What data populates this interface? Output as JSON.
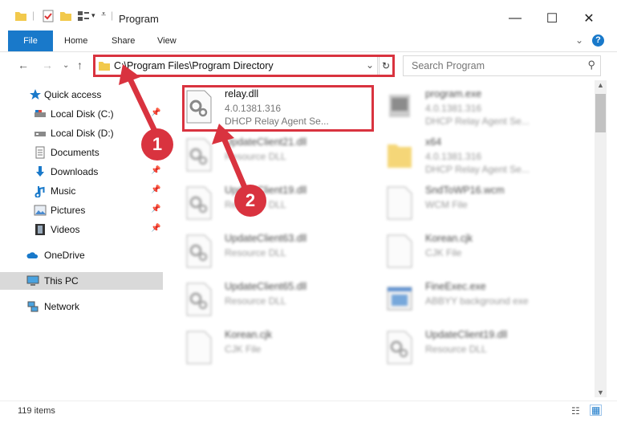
{
  "window": {
    "title": "Program",
    "minimize_glyph": "—",
    "maximize_glyph": "☐",
    "close_glyph": "✕"
  },
  "ribbon": {
    "tabs": [
      "File",
      "Home",
      "Share",
      "View"
    ]
  },
  "address": {
    "path": "C:\\Program Files\\Program Directory",
    "search_placeholder": "Search Program"
  },
  "nav": {
    "items": [
      {
        "label": "Quick access",
        "icon": "star-icon",
        "pinned": false
      },
      {
        "label": "Local Disk (C:)",
        "icon": "drive-icon",
        "pinned": true
      },
      {
        "label": "Local Disk (D:)",
        "icon": "drive-icon",
        "pinned": false
      },
      {
        "label": "Documents",
        "icon": "documents-icon",
        "pinned": false
      },
      {
        "label": "Downloads",
        "icon": "downloads-icon",
        "pinned": true
      },
      {
        "label": "Music",
        "icon": "music-icon",
        "pinned": true
      },
      {
        "label": "Pictures",
        "icon": "pictures-icon",
        "pinned": true
      },
      {
        "label": "Videos",
        "icon": "videos-icon",
        "pinned": true
      },
      {
        "label": "OneDrive",
        "icon": "onedrive-icon",
        "pinned": false
      },
      {
        "label": "This PC",
        "icon": "this-pc-icon",
        "pinned": false,
        "selected": true
      },
      {
        "label": "Network",
        "icon": "network-icon",
        "pinned": false
      }
    ]
  },
  "files": [
    {
      "name": "relay.dll",
      "line1": "4.0.1381.316",
      "line2": "DHCP Relay Agent Se...",
      "icon": "dll-gear-icon",
      "highlighted": true
    },
    {
      "name": "program.exe",
      "line1": "4.0.1381.316",
      "line2": "DHCP Relay Agent Se...",
      "icon": "exe-icon"
    },
    {
      "name": "UpdateClient21.dll",
      "line1": "Resource DLL",
      "line2": "",
      "icon": "dll-gear-icon"
    },
    {
      "name": "x64",
      "line1": "4.0.1381.316",
      "line2": "DHCP Relay Agent Se...",
      "icon": "folder-icon"
    },
    {
      "name": "UpdateClient19.dll",
      "line1": "Resource DLL",
      "line2": "",
      "icon": "dll-gear-icon"
    },
    {
      "name": "SndToWP16.wcm",
      "line1": "WCM File",
      "line2": "",
      "icon": "blank-file-icon"
    },
    {
      "name": "UpdateClient63.dll",
      "line1": "Resource DLL",
      "line2": "",
      "icon": "dll-gear-icon"
    },
    {
      "name": "Korean.cjk",
      "line1": "CJK File",
      "line2": "",
      "icon": "blank-file-icon"
    },
    {
      "name": "UpdateClient65.dll",
      "line1": "Resource DLL",
      "line2": "",
      "icon": "dll-gear-icon"
    },
    {
      "name": "FineExec.exe",
      "line1": "ABBYY background exe",
      "line2": "",
      "icon": "app-window-icon"
    },
    {
      "name": "Korean.cjk",
      "line1": "CJK File",
      "line2": "",
      "icon": "blank-file-icon"
    },
    {
      "name": "UpdateClient19.dll",
      "line1": "Resource DLL",
      "line2": "",
      "icon": "dll-gear-icon"
    }
  ],
  "status": {
    "item_count": "119 items"
  },
  "annotations": {
    "step1": "1",
    "step2": "2"
  },
  "colors": {
    "accent": "#1979ca",
    "annotation_red": "#d9333f",
    "folder_yellow": "#f2c94c"
  }
}
